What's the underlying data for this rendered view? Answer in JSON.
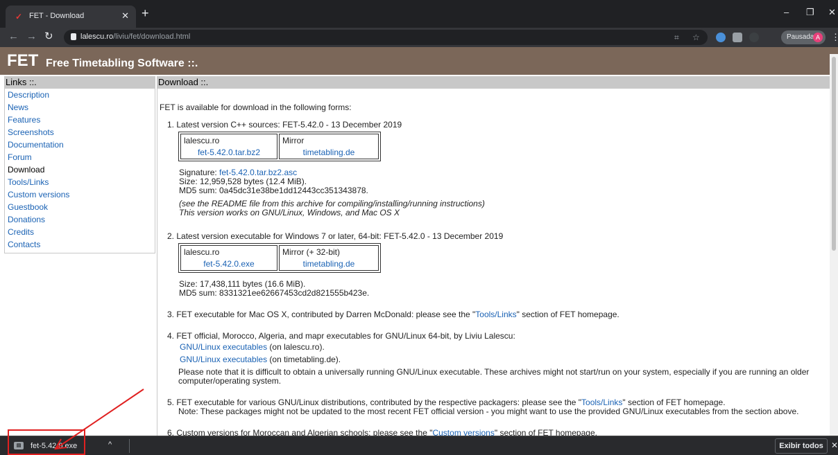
{
  "browser": {
    "tab_title": "FET - Download",
    "tab_favicon": "fet-favicon-icon",
    "url_host": "lalescu.ro",
    "url_path": "/liviu/fet/download.html",
    "profile_status": "Pausada",
    "profile_initial": "A"
  },
  "banner": {
    "logo": "FET",
    "subtitle": "Free Timetabling Software ::."
  },
  "sidebar": {
    "header": "Links ::.",
    "items": [
      {
        "label": "Description"
      },
      {
        "label": "News"
      },
      {
        "label": "Features"
      },
      {
        "label": "Screenshots"
      },
      {
        "label": "Documentation"
      },
      {
        "label": "Forum"
      },
      {
        "label": "Download",
        "current": true
      },
      {
        "label": "Tools/Links"
      },
      {
        "label": "Custom versions"
      },
      {
        "label": "Guestbook"
      },
      {
        "label": "Donations"
      },
      {
        "label": "Credits"
      },
      {
        "label": "Contacts"
      }
    ]
  },
  "main": {
    "header": "Download ::.",
    "intro": "FET is available for download in the following forms:",
    "item1": {
      "title": "1. Latest version C++ sources: FET-5.42.0 - 13 December 2019",
      "col1_head": "lalescu.ro",
      "col1_link": "fet-5.42.0.tar.bz2",
      "col2_head": "Mirror",
      "col2_link": "timetabling.de",
      "signature_label": "Signature: ",
      "signature_link": "fet-5.42.0.tar.bz2.asc",
      "size": "Size: 12,959,528 bytes (12.4 MiB).",
      "md5": "MD5 sum: 0a45dc31e38be1dd12443cc351343878.",
      "note1": "(see the README file from this archive for compiling/installing/running instructions)",
      "note2": "This version works on GNU/Linux, Windows, and Mac OS X"
    },
    "item2": {
      "title": "2. Latest version executable for Windows 7 or later, 64-bit: FET-5.42.0 - 13 December 2019",
      "col1_head": "lalescu.ro",
      "col1_link": "fet-5.42.0.exe",
      "col2_head": "Mirror (+ 32-bit)",
      "col2_link": "timetabling.de",
      "size": "Size: 17,438,111 bytes (16.6 MiB).",
      "md5": "MD5 sum: 8331321ee62667453cd2d821555b423e."
    },
    "item3": {
      "pre": "3. FET executable for Mac OS X, contributed by Darren McDonald: please see the \"",
      "link": "Tools/Links",
      "post": "\" section of FET homepage."
    },
    "item4": {
      "title": "4. FET official, Morocco, Algeria, and mapr executables for GNU/Linux 64-bit, by Liviu Lalescu:",
      "link1": "GNU/Linux executables",
      "link1_post": " (on lalescu.ro).",
      "link2": "GNU/Linux executables",
      "link2_post": " (on timetabling.de).",
      "note_line1": "Please note that it is difficult to obtain a universally running GNU/Linux executable. These archives might not start/run on your system, especially if you are running an older",
      "note_line2": "computer/operating system."
    },
    "item5": {
      "pre": "5. FET executable for various GNU/Linux distributions, contributed by the respective packagers: please see the \"",
      "link": "Tools/Links",
      "post": "\" section of FET homepage.",
      "note": "Note: These packages might not be updated to the most recent FET official version - you might want to use the provided GNU/Linux executables from the section above."
    },
    "item6": {
      "pre": "6. Custom versions for Moroccan and Algerian schools: please see the \"",
      "link": "Custom versions",
      "post": "\" section of FET homepage."
    }
  },
  "download_shelf": {
    "file_name": "fet-5.42.0.exe",
    "show_all": "Exibir todos"
  }
}
